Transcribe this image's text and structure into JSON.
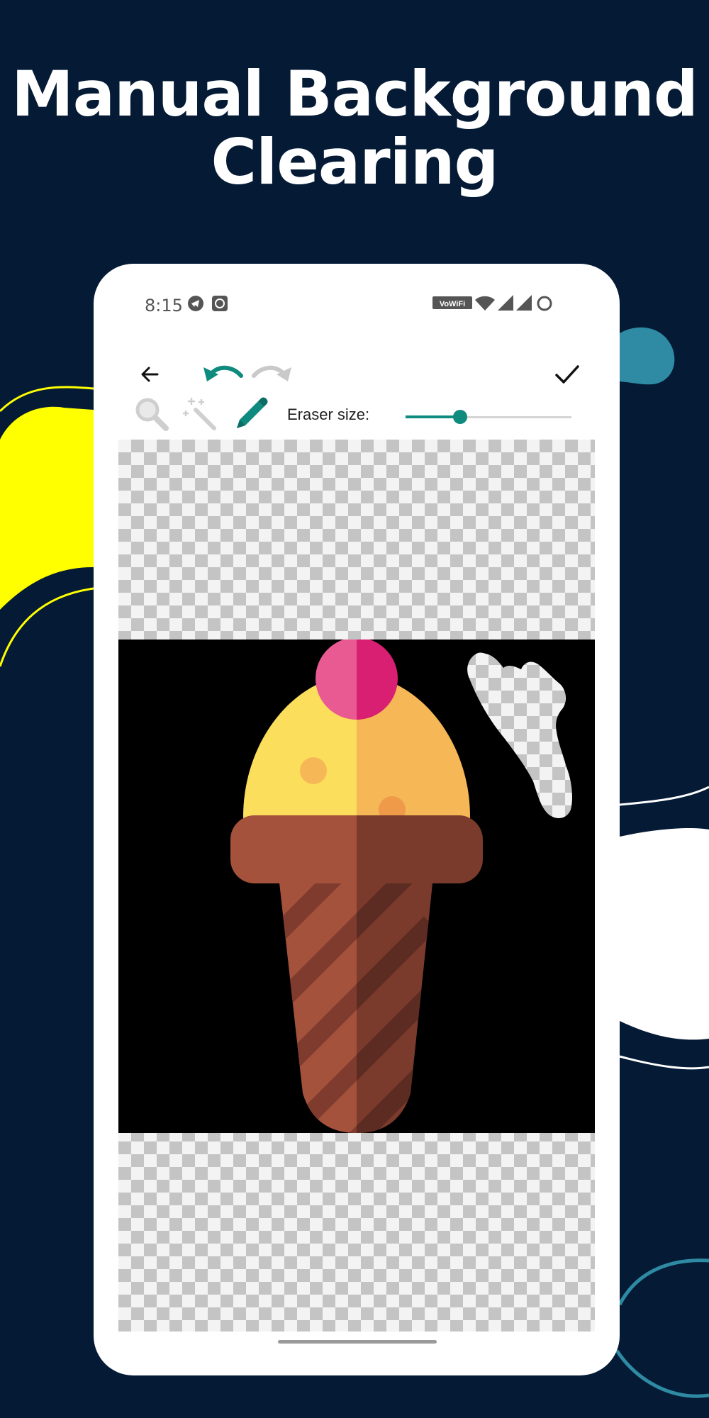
{
  "colors": {
    "background": "#041a35",
    "accent": "#0f8a7e",
    "decor_yellow": "#ffff00",
    "decor_teal": "#2f8aa3"
  },
  "headline": {
    "line1": "Manual Background",
    "line2": "Clearing"
  },
  "statusbar": {
    "time": "8:15",
    "icons": [
      "telegram-icon",
      "app-notification-icon",
      "vowifi-icon",
      "wifi-icon",
      "signal-icon",
      "signal-icon",
      "battery-icon"
    ],
    "vowifi_label": "VoWiFi"
  },
  "toolbar": {
    "back_icon": "arrow-left-icon",
    "undo_icon": "undo-icon",
    "redo_icon": "redo-icon",
    "done_icon": "check-icon"
  },
  "tools": {
    "items": [
      {
        "icon": "magnifier-icon",
        "active": false
      },
      {
        "icon": "magic-wand-icon",
        "active": false
      },
      {
        "icon": "pencil-eraser-icon",
        "active": true
      }
    ],
    "eraser_label": "Eraser size:",
    "eraser_size_fraction": 0.33
  }
}
